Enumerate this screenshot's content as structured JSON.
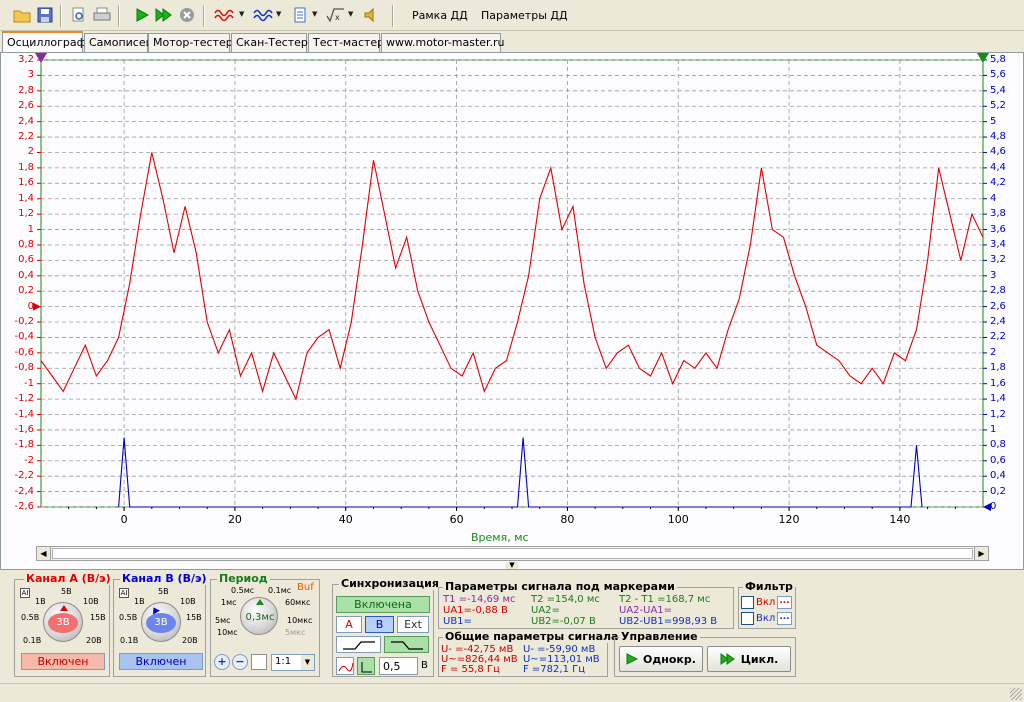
{
  "toolbar": {
    "icons": [
      "open-folder-icon",
      "save-icon",
      "print-preview-icon",
      "print-icon",
      "play-icon",
      "play-fast-icon",
      "stop-icon",
      "channel-a-wave-icon",
      "channel-b-wave-icon",
      "document-icon",
      "math-sqrt-icon",
      "sound-icon"
    ],
    "frame_label": "Рамка ДД",
    "params_label": "Параметры ДД"
  },
  "tabs": [
    "Осциллограф",
    "Самописец",
    "Мотор-тестер",
    "Скан-Тестер",
    "Тест-мастер",
    "www.motor-master.ru"
  ],
  "plot": {
    "x_label": "Время, мс",
    "colors": {
      "channel_a": "#e00000",
      "channel_b": "#0000c0",
      "grid": "#9a9a9a",
      "axis_green": "#1a8a1a"
    }
  },
  "chart_data": {
    "type": "line",
    "xlabel": "Время, мс",
    "xlim": [
      -15,
      155
    ],
    "x_ticks": [
      "0",
      "20",
      "40",
      "60",
      "80",
      "100",
      "120",
      "140"
    ],
    "y_left_ticks": [
      "3,2",
      "3",
      "2,8",
      "2,6",
      "2,4",
      "2,2",
      "2",
      "1,8",
      "1,6",
      "1,4",
      "1,2",
      "1",
      "0,8",
      "0,6",
      "0,4",
      "0,2",
      "0",
      "-0,2",
      "-0,4",
      "-0,6",
      "-0,8",
      "-1",
      "-1,2",
      "-1,4",
      "-1,6",
      "-1,8",
      "-2",
      "-2,2",
      "-2,4",
      "-2,6"
    ],
    "y_right_ticks": [
      "5,8",
      "5,6",
      "5,4",
      "5,2",
      "5",
      "4,8",
      "4,6",
      "4,4",
      "4,2",
      "4",
      "3,8",
      "3,6",
      "3,4",
      "3,2",
      "3",
      "2,8",
      "2,6",
      "2,4",
      "2,2",
      "2",
      "1,8",
      "1,6",
      "1,4",
      "1,2",
      "1",
      "0,8",
      "0,6",
      "0,4",
      "0,2",
      "0"
    ],
    "ylim_left": [
      -2.6,
      3.2
    ],
    "ylim_right": [
      0,
      5.8
    ],
    "grid": true,
    "series": [
      {
        "color": "#e00000",
        "axis": "left",
        "x": [
          -15,
          -13,
          -11,
          -9,
          -7,
          -5,
          -3,
          -1,
          1,
          3,
          5,
          7,
          9,
          11,
          13,
          15,
          17,
          19,
          21,
          23,
          25,
          27,
          29,
          31,
          33,
          35,
          37,
          39,
          41,
          43,
          45,
          47,
          49,
          51,
          53,
          55,
          57,
          59,
          61,
          63,
          65,
          67,
          69,
          71,
          73,
          75,
          77,
          79,
          81,
          83,
          85,
          87,
          89,
          91,
          93,
          95,
          97,
          99,
          101,
          103,
          105,
          107,
          109,
          111,
          113,
          115,
          117,
          119,
          121,
          123,
          125,
          127,
          129,
          131,
          133,
          135,
          137,
          139,
          141,
          143,
          145,
          147,
          149,
          151,
          153,
          155
        ],
        "values": [
          -0.7,
          -0.9,
          -1.1,
          -0.8,
          -0.5,
          -0.9,
          -0.7,
          -0.4,
          0.3,
          1.2,
          2.0,
          1.4,
          0.7,
          1.3,
          0.7,
          -0.2,
          -0.6,
          -0.3,
          -0.9,
          -0.6,
          -1.1,
          -0.6,
          -0.9,
          -1.2,
          -0.6,
          -0.4,
          -0.3,
          -0.8,
          -0.2,
          0.8,
          1.9,
          1.2,
          0.5,
          0.9,
          0.2,
          -0.2,
          -0.5,
          -0.8,
          -0.9,
          -0.6,
          -1.1,
          -0.8,
          -0.7,
          -0.2,
          0.4,
          1.4,
          1.8,
          1.0,
          1.3,
          0.3,
          -0.4,
          -0.8,
          -0.6,
          -0.5,
          -0.8,
          -0.9,
          -0.6,
          -1.0,
          -0.7,
          -0.8,
          -0.6,
          -0.8,
          -0.3,
          0.1,
          0.8,
          1.8,
          1.0,
          0.9,
          0.4,
          0.0,
          -0.5,
          -0.6,
          -0.7,
          -0.9,
          -1.0,
          -0.8,
          -1.0,
          -0.6,
          -0.7,
          -0.3,
          0.6,
          1.8,
          1.2,
          0.6,
          1.2,
          0.9
        ]
      },
      {
        "color": "#0000c0",
        "axis": "right",
        "x": [
          -1,
          0,
          1,
          71,
          72,
          73,
          142,
          143,
          144
        ],
        "values": [
          0,
          0.9,
          0,
          0,
          0.9,
          0,
          0,
          0.8,
          0
        ]
      }
    ]
  },
  "channel_a": {
    "title": "Канал А (В/э)",
    "marks": [
      "1В",
      "5В",
      "10В",
      "0.5В",
      "15В",
      "0.1В",
      "20В"
    ],
    "value": "3В",
    "state": "Включен"
  },
  "channel_b": {
    "title": "Канал В (В/э)",
    "marks": [
      "1В",
      "5В",
      "10В",
      "0.5В",
      "15В",
      "0.1В",
      "20В"
    ],
    "value": "3В",
    "state": "Включен"
  },
  "period": {
    "title": "Период",
    "marks": [
      "0.5мс",
      "0.1мс",
      "1мс",
      "60мкс",
      "5мс",
      "10мкс",
      "10мс",
      "5мкс"
    ],
    "value": "0,3мс",
    "buf": "Buf",
    "ratio": "1:1"
  },
  "sync": {
    "title": "Синхронизация",
    "state": "Включена",
    "sources": [
      "A",
      "B",
      "Ext"
    ],
    "level": "0,5",
    "unit": "В"
  },
  "marker_params": {
    "title": "Параметры сигнала под маркерами",
    "t1": "T1 =-14,69 мс",
    "t2": "T2 =154,0 мс",
    "dt": "T2 - T1 =168,7 мс",
    "ua1": "UA1=-0,88 В",
    "ua2": "UA2=",
    "dua": "UA2-UA1=",
    "ub1": "UB1=",
    "ub2": "UB2=-0,07 В",
    "dub": "UB2-UB1=998,93 В"
  },
  "general_params": {
    "title": "Общие параметры сигнала",
    "a_lines": [
      "U- =-42,75 мВ",
      "U~=826,44 мВ",
      "F = 55,8 Гц"
    ],
    "b_lines": [
      "U- =-59,90 мВ",
      "U~=113,01 мВ",
      "F =782,1 Гц"
    ]
  },
  "filter": {
    "title": "Фильтр",
    "a_label": "Вкл",
    "b_label": "Вкл",
    "dots": "..."
  },
  "control": {
    "title": "Управление",
    "single": "Однокр.",
    "cycle": "Цикл."
  }
}
